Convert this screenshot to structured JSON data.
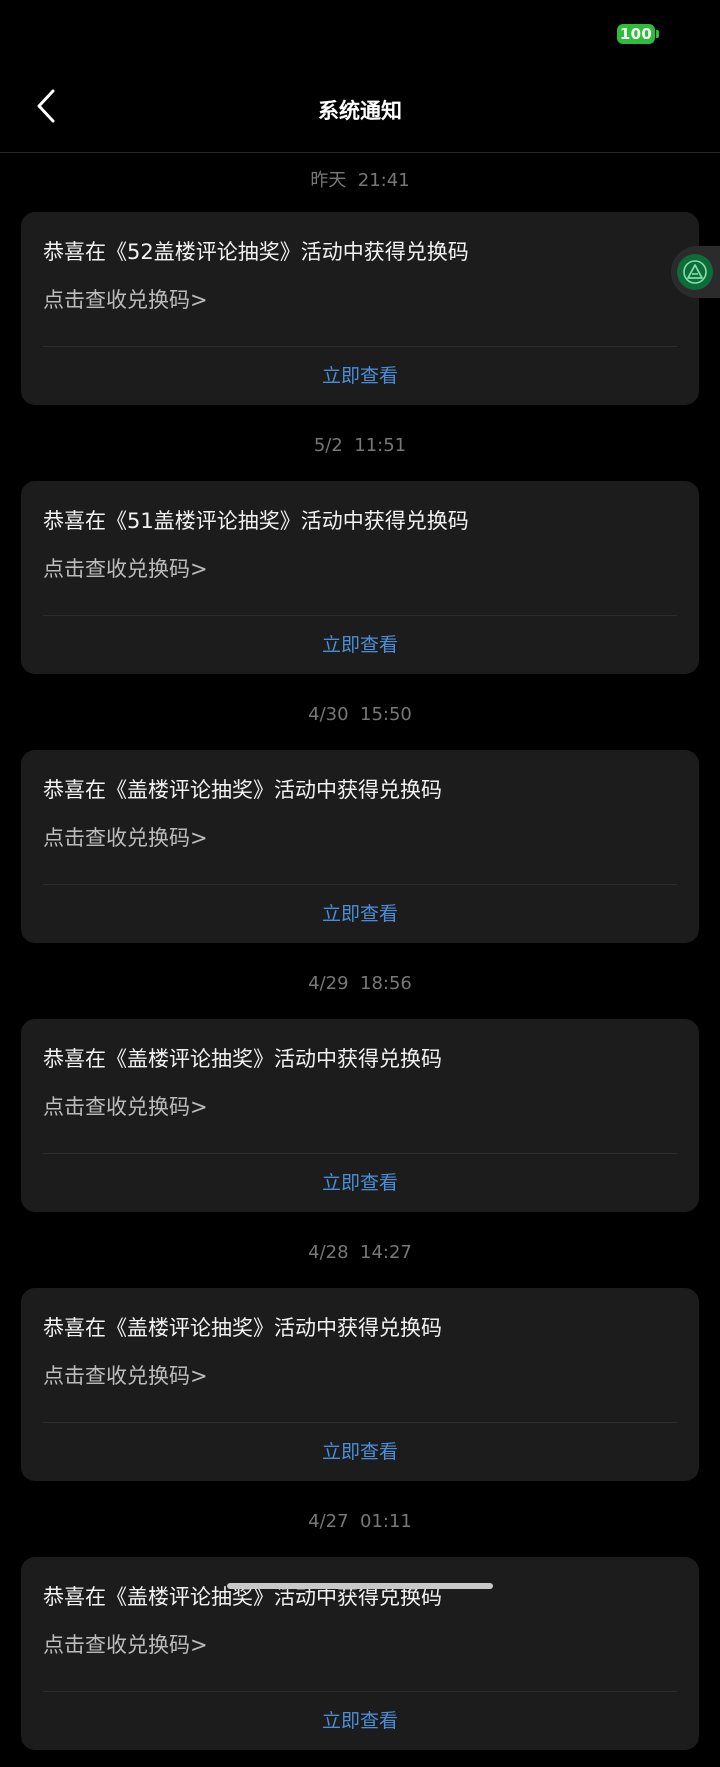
{
  "status_bar": {
    "battery_level": "100",
    "battery_color": "#2dbd3a"
  },
  "header": {
    "title": "系统通知",
    "back_icon": "chevron-left-icon"
  },
  "floating_button": {
    "icon": "assistant-logo-icon"
  },
  "theme": {
    "background": "#000000",
    "card_background": "#1c1c1c",
    "accent_link": "#4b8ed8"
  },
  "notifications": [
    {
      "time": "昨天  21:41",
      "title": "恭喜在《52盖楼评论抽奖》活动中获得兑换码",
      "subtitle": "点击查收兑换码>",
      "action": "立即查看"
    },
    {
      "time": "5/2  11:51",
      "title": "恭喜在《51盖楼评论抽奖》活动中获得兑换码",
      "subtitle": "点击查收兑换码>",
      "action": "立即查看"
    },
    {
      "time": "4/30  15:50",
      "title": "恭喜在《盖楼评论抽奖》活动中获得兑换码",
      "subtitle": "点击查收兑换码>",
      "action": "立即查看"
    },
    {
      "time": "4/29  18:56",
      "title": "恭喜在《盖楼评论抽奖》活动中获得兑换码",
      "subtitle": "点击查收兑换码>",
      "action": "立即查看"
    },
    {
      "time": "4/28  14:27",
      "title": "恭喜在《盖楼评论抽奖》活动中获得兑换码",
      "subtitle": "点击查收兑换码>",
      "action": "立即查看"
    },
    {
      "time": "4/27  01:11",
      "title": "恭喜在《盖楼评论抽奖》活动中获得兑换码",
      "subtitle": "点击查收兑换码>",
      "action": "立即查看"
    }
  ]
}
